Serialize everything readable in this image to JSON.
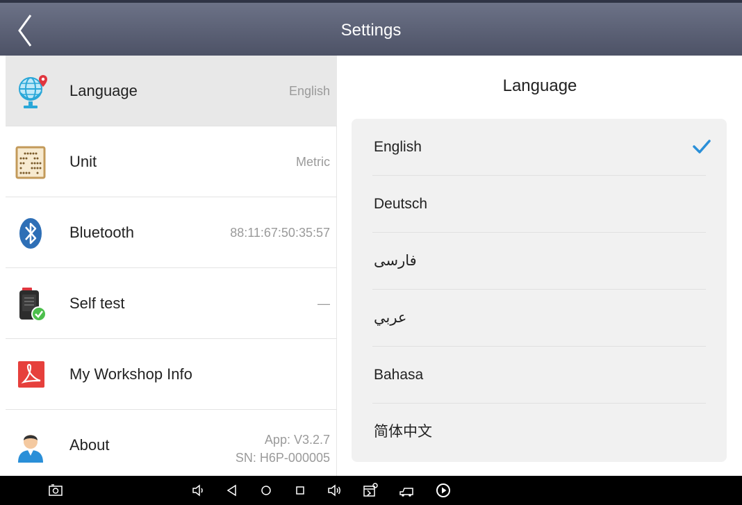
{
  "header": {
    "title": "Settings"
  },
  "settings": {
    "items": [
      {
        "label": "Language",
        "value": "English"
      },
      {
        "label": "Unit",
        "value": "Metric"
      },
      {
        "label": "Bluetooth",
        "value": "88:11:67:50:35:57"
      },
      {
        "label": "Self test",
        "value": "—"
      },
      {
        "label": "My Workshop Info",
        "value": ""
      },
      {
        "label": "About",
        "value": "App: V3.2.7",
        "value2": "SN: H6P-000005"
      }
    ]
  },
  "language_panel": {
    "title": "Language",
    "selected": "English",
    "options": [
      "English",
      "Deutsch",
      "فارسی",
      "عربي",
      "Bahasa",
      "简体中文"
    ]
  },
  "icons": {
    "back": "back-chevron-icon",
    "language": "globe-icon",
    "unit": "abacus-icon",
    "bluetooth": "bluetooth-icon",
    "self_test": "device-check-icon",
    "workshop": "pdf-icon",
    "about": "user-avatar-icon",
    "check": "checkmark-icon"
  },
  "colors": {
    "header": "#5a5f73",
    "accent": "#2a8fd8",
    "selected_row": "#e8e8e8",
    "panel_bg": "#f1f1f1"
  }
}
